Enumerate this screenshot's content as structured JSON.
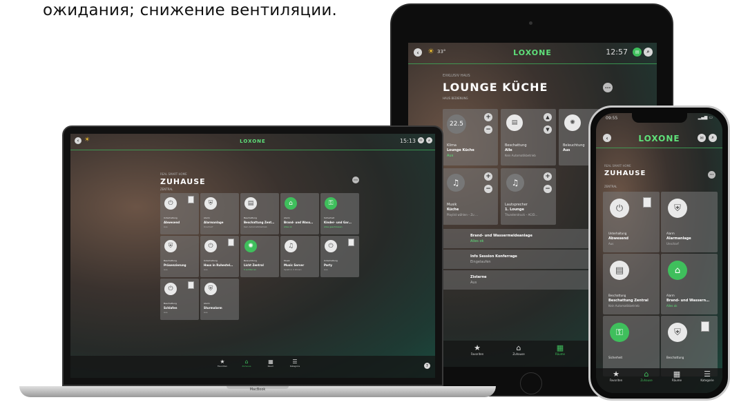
{
  "caption": "ожидания; снижение вентиляции.",
  "laptop": {
    "brand": "LOXONE",
    "time": "15:13",
    "subtitle": "REAL SMART HOME",
    "title": "ZUHAUSE",
    "section": "ZENTRAL",
    "tiles": [
      {
        "cat": "Unterhaltung",
        "name": "Abwesend",
        "state": "Aus",
        "icon": "power-icon",
        "green": false
      },
      {
        "cat": "Alarm",
        "name": "Alarmanlage",
        "state": "Unscharf",
        "icon": "shield-icon",
        "green": false
      },
      {
        "cat": "Beschattung",
        "name": "Beschattung Zent…",
        "state": "Kein Automatikbetrieb",
        "icon": "blind-icon",
        "green": false
      },
      {
        "cat": "Alarm",
        "name": "Brand- und Wass…",
        "state": "Alles ok",
        "icon": "home-icon",
        "green": true
      },
      {
        "cat": "Sicherheit",
        "name": "Kinder- und Gar…",
        "state": "Alles geschlossen",
        "icon": "lock-icon",
        "green": true
      },
      {
        "cat": "Beschattung",
        "name": "Präsenzierung",
        "state": "Aus",
        "icon": "shield-icon",
        "green": false
      },
      {
        "cat": "Unterhaltung",
        "name": "Haus in Ruhestel…",
        "state": "Aus",
        "icon": "power-icon",
        "green": false
      },
      {
        "cat": "Beleuchtung",
        "name": "Licht Zentral",
        "state": "5 Lichter an",
        "icon": "light-icon",
        "green": true
      },
      {
        "cat": "Musik",
        "name": "Music Server",
        "state": "Spielt in 2 Zonen",
        "icon": "music-icon",
        "green": false
      },
      {
        "cat": "Unterhaltung",
        "name": "Party",
        "state": "Aus",
        "icon": "power-icon",
        "green": false
      },
      {
        "cat": "Beschattung",
        "name": "Schlafen",
        "state": "Aus",
        "icon": "power-icon",
        "green": false
      },
      {
        "cat": "Alarm",
        "name": "Sturmalarm",
        "state": "Aus",
        "icon": "shield-icon",
        "green": false
      }
    ],
    "nav": [
      {
        "label": "Favoriten",
        "icon": "star-icon"
      },
      {
        "label": "Zuhause",
        "icon": "home-icon"
      },
      {
        "label": "Raum",
        "icon": "room-icon"
      },
      {
        "label": "Kategorie",
        "icon": "category-icon"
      }
    ],
    "base_label": "MacBook"
  },
  "tablet": {
    "brand": "LOXONE",
    "temp": "33°",
    "time": "12:57",
    "subtitle": "EXKLUSIV HAUS",
    "title": "LOUNGE KÜCHE",
    "section": "HAUS BEDIENUNG",
    "climate_value": "22.5",
    "tiles": [
      {
        "cat": "Klima",
        "name": "Lounge Küche",
        "state": "Aus"
      },
      {
        "cat": "Beschattung",
        "name": "Alle",
        "state": "Kein Automatikbetrieb"
      },
      {
        "cat": "Beleuchtung",
        "name": "Aus",
        "state": ""
      },
      {
        "cat": "Musik",
        "name": "Küche",
        "state": "Playlist wählen – Zu …"
      },
      {
        "cat": "Lautsprecher",
        "name": "1. Lounge",
        "state": "Thunderstruck – AC/D…"
      }
    ],
    "rows": [
      {
        "name": "Brand- und Wassermeldeanlage",
        "state": "Alles ok"
      },
      {
        "name": "Info Session Konferrage",
        "state": "Eingelaufen"
      },
      {
        "name": "Zisterne",
        "state": "Aus"
      }
    ],
    "nav": [
      {
        "label": "Favoriten",
        "icon": "star-icon"
      },
      {
        "label": "Zuhause",
        "icon": "home-icon"
      },
      {
        "label": "Räume",
        "icon": "room-icon"
      },
      {
        "label": "Kategorie",
        "icon": "category-icon"
      }
    ]
  },
  "phone": {
    "brand": "LOXONE",
    "time": "09:55",
    "subtitle": "REAL SMART HOME",
    "title": "ZUHAUSE",
    "section": "ZENTRAL",
    "tiles": [
      {
        "cat": "Unterhaltung",
        "name": "Abwesend",
        "state": "Aus",
        "green": false
      },
      {
        "cat": "Alarm",
        "name": "Alarmanlage",
        "state": "Unscharf",
        "green": false
      },
      {
        "cat": "Beschattung",
        "name": "Beschattung Zentral",
        "state": "Kein Automatikbetrieb",
        "green": false
      },
      {
        "cat": "Alarm",
        "name": "Brand- und Wassern…",
        "state": "Alles ok",
        "green": true
      },
      {
        "cat": "Sicherheit",
        "name": "",
        "state": "",
        "green": true
      },
      {
        "cat": "Beschattung",
        "name": "",
        "state": "",
        "green": false
      }
    ],
    "nav": [
      {
        "label": "Favoriten",
        "icon": "star-icon"
      },
      {
        "label": "Zuhause",
        "icon": "home-icon"
      },
      {
        "label": "Räume",
        "icon": "room-icon"
      },
      {
        "label": "Kategorie",
        "icon": "category-icon"
      }
    ]
  }
}
